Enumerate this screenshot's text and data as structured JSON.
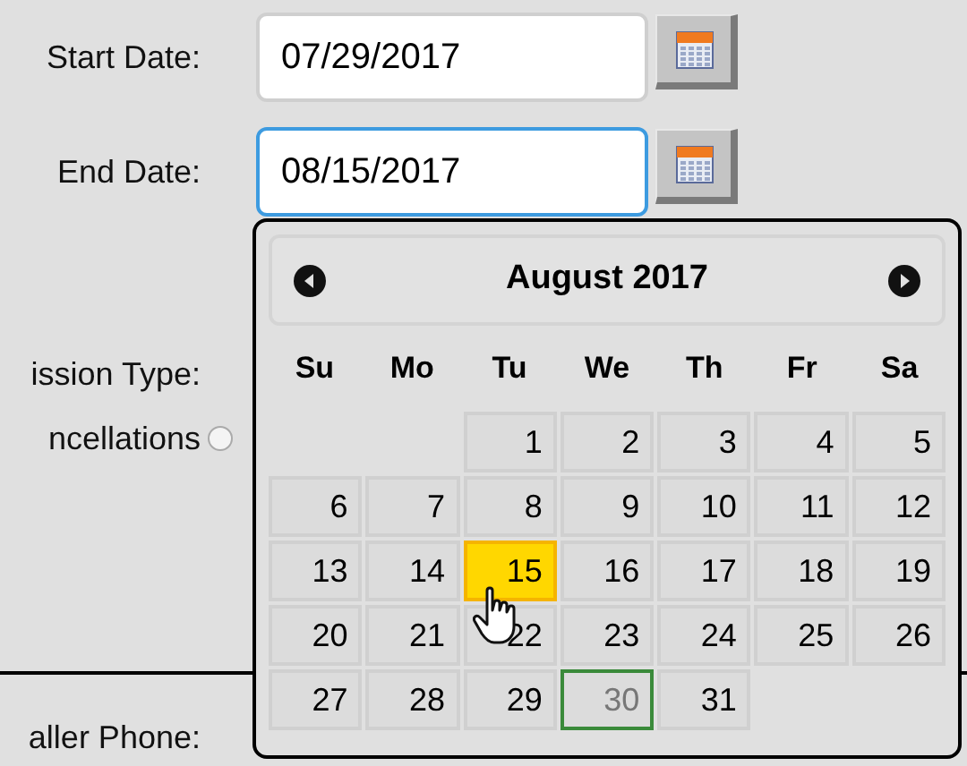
{
  "fields": [
    {
      "label": "Start Date:",
      "value": "07/29/2017",
      "focused": false
    },
    {
      "label": "End Date:",
      "value": "08/15/2017",
      "focused": true
    }
  ],
  "partial_rows": [
    {
      "label": "ission Type:"
    },
    {
      "label": "ncellations",
      "radio": {
        "checked": false
      }
    }
  ],
  "bottom_label": "aller Phone:",
  "datepicker": {
    "title": "August 2017",
    "weekdays": [
      "Su",
      "Mo",
      "Tu",
      "We",
      "Th",
      "Fr",
      "Sa"
    ],
    "weeks": [
      [
        {
          "kind": "blank"
        },
        {
          "kind": "blank"
        },
        {
          "kind": "day",
          "label": "1",
          "selected": false,
          "today": false
        },
        {
          "kind": "day",
          "label": "2",
          "selected": false,
          "today": false
        },
        {
          "kind": "day",
          "label": "3",
          "selected": false,
          "today": false
        },
        {
          "kind": "day",
          "label": "4",
          "selected": false,
          "today": false
        },
        {
          "kind": "day",
          "label": "5",
          "selected": false,
          "today": false
        }
      ],
      [
        {
          "kind": "day",
          "label": "6",
          "selected": false,
          "today": false
        },
        {
          "kind": "day",
          "label": "7",
          "selected": false,
          "today": false
        },
        {
          "kind": "day",
          "label": "8",
          "selected": false,
          "today": false
        },
        {
          "kind": "day",
          "label": "9",
          "selected": false,
          "today": false
        },
        {
          "kind": "day",
          "label": "10",
          "selected": false,
          "today": false
        },
        {
          "kind": "day",
          "label": "11",
          "selected": false,
          "today": false
        },
        {
          "kind": "day",
          "label": "12",
          "selected": false,
          "today": false
        }
      ],
      [
        {
          "kind": "day",
          "label": "13",
          "selected": false,
          "today": false
        },
        {
          "kind": "day",
          "label": "14",
          "selected": false,
          "today": false
        },
        {
          "kind": "day",
          "label": "15",
          "selected": true,
          "today": false
        },
        {
          "kind": "day",
          "label": "16",
          "selected": false,
          "today": false
        },
        {
          "kind": "day",
          "label": "17",
          "selected": false,
          "today": false
        },
        {
          "kind": "day",
          "label": "18",
          "selected": false,
          "today": false
        },
        {
          "kind": "day",
          "label": "19",
          "selected": false,
          "today": false
        }
      ],
      [
        {
          "kind": "day",
          "label": "20",
          "selected": false,
          "today": false
        },
        {
          "kind": "day",
          "label": "21",
          "selected": false,
          "today": false
        },
        {
          "kind": "day",
          "label": "22",
          "selected": false,
          "today": false
        },
        {
          "kind": "day",
          "label": "23",
          "selected": false,
          "today": false
        },
        {
          "kind": "day",
          "label": "24",
          "selected": false,
          "today": false
        },
        {
          "kind": "day",
          "label": "25",
          "selected": false,
          "today": false
        },
        {
          "kind": "day",
          "label": "26",
          "selected": false,
          "today": false
        }
      ],
      [
        {
          "kind": "day",
          "label": "27",
          "selected": false,
          "today": false
        },
        {
          "kind": "day",
          "label": "28",
          "selected": false,
          "today": false
        },
        {
          "kind": "day",
          "label": "29",
          "selected": false,
          "today": false
        },
        {
          "kind": "day",
          "label": "30",
          "selected": false,
          "today": true
        },
        {
          "kind": "day",
          "label": "31",
          "selected": false,
          "today": false
        },
        {
          "kind": "blank"
        },
        {
          "kind": "blank"
        }
      ]
    ]
  }
}
